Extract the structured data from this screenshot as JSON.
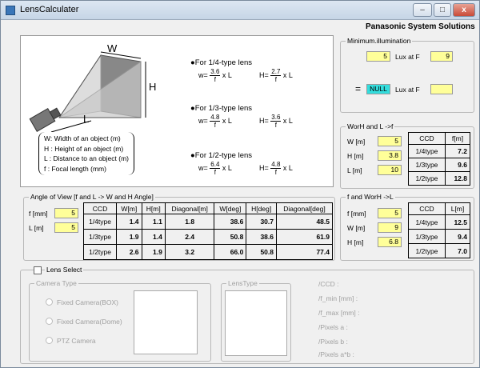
{
  "window": {
    "title": "LensCalculater",
    "minimize": "–",
    "maximize": "□",
    "close": "x"
  },
  "brand": "Panasonic System Solutions",
  "diagram": {
    "label_w": "W",
    "label_h": "H",
    "label_l": "L",
    "definitions": [
      "W: Width of an object (m)",
      "H : Height of an object (m)",
      "L : Distance to an object (m)",
      "f  : Focal length  (mm)"
    ],
    "lenses": [
      {
        "heading": "●For 1/4-type lens",
        "w_num": "3.6",
        "h_num": "2.7",
        "den": "f",
        "suffix": "x L",
        "w_pre": "w=",
        "h_pre": "H="
      },
      {
        "heading": "●For 1/3-type lens",
        "w_num": "4.8",
        "h_num": "3.6",
        "den": "f",
        "suffix": "x L",
        "w_pre": "w=",
        "h_pre": "H="
      },
      {
        "heading": "●For 1/2-type lens",
        "w_num": "6.4",
        "h_num": "4.8",
        "den": "f",
        "suffix": "x L",
        "w_pre": "w=",
        "h_pre": "H="
      }
    ]
  },
  "min_illum": {
    "title": "Minimum.illumination",
    "row1": {
      "value": "5",
      "label": "Lux at F",
      "f": "9"
    },
    "row2": {
      "eq": "=",
      "value": "NULL",
      "label": "Lux at F",
      "f": ""
    }
  },
  "worh": {
    "title": "WorH and L ->f",
    "inputs": [
      {
        "label": "W [m]",
        "value": "5"
      },
      {
        "label": "H [m]",
        "value": "3.8"
      },
      {
        "label": "L [m]",
        "value": "10"
      }
    ],
    "headers": [
      "CCD",
      "f[m]"
    ],
    "rows": [
      [
        "1/4type",
        "7.2"
      ],
      [
        "1/3type",
        "9.6"
      ],
      [
        "1/2type",
        "12.8"
      ]
    ]
  },
  "fworh": {
    "title": "f and WorH ->L",
    "inputs": [
      {
        "label": "f [mm]",
        "value": "5"
      },
      {
        "label": "W [m]",
        "value": "9"
      },
      {
        "label": "H [m]",
        "value": "6.8"
      }
    ],
    "headers": [
      "CCD",
      "L[m]"
    ],
    "rows": [
      [
        "1/4type",
        "12.5"
      ],
      [
        "1/3type",
        "9.4"
      ],
      [
        "1/2type",
        "7.0"
      ]
    ]
  },
  "angle": {
    "title": "Angle of View [f and L -> W and H Angle]",
    "inputs": [
      {
        "label": "f [mm]",
        "value": "5"
      },
      {
        "label": "L [m]",
        "value": "5"
      }
    ],
    "headers": [
      "CCD",
      "W[m]",
      "H[m]",
      "Diagonal[m]",
      "W[deg]",
      "H[deg]",
      "Diagonal[deg]"
    ],
    "rows": [
      [
        "1/4type",
        "1.4",
        "1.1",
        "1.8",
        "38.6",
        "30.7",
        "48.5"
      ],
      [
        "1/3type",
        "1.9",
        "1.4",
        "2.4",
        "50.8",
        "38.6",
        "61.9"
      ],
      [
        "1/2type",
        "2.6",
        "1.9",
        "3.2",
        "66.0",
        "50.8",
        "77.4"
      ]
    ]
  },
  "lens_select": {
    "label": "Lens Select",
    "camera_type": "Camera Type",
    "options": [
      "Fixed Camera(BOX)",
      "Fixed Camera(Dome)",
      "PTZ Camera"
    ],
    "lens_type": "LensType",
    "info": [
      "/CCD          :",
      "/f_min [mm] :",
      "/f_max [mm] :",
      "/Pixels a      :",
      "/Pixels b      :",
      "/Pixels a*b   :"
    ]
  }
}
